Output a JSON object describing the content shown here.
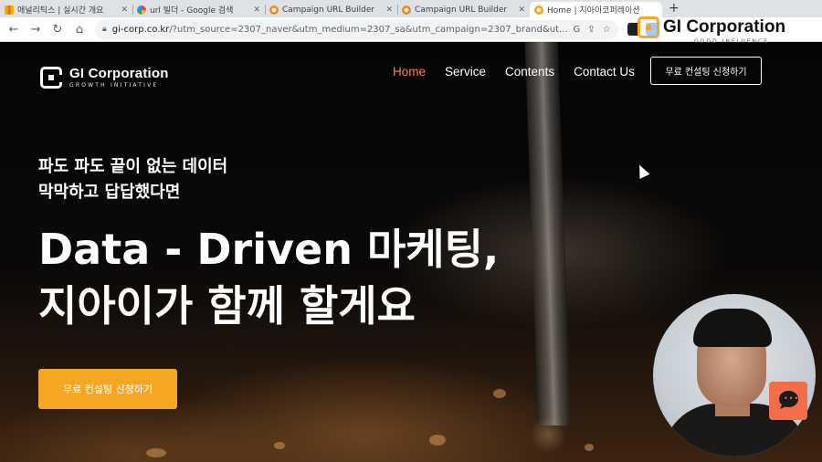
{
  "browser": {
    "tabs": [
      {
        "label": "애널리틱스 | 실시간 개요",
        "icon": "analytics-icon",
        "active": false
      },
      {
        "label": "url 빌더 - Google 검색",
        "icon": "google-icon",
        "active": false
      },
      {
        "label": "Campaign URL Builder",
        "icon": "gear-icon",
        "active": false
      },
      {
        "label": "Campaign URL Builder",
        "icon": "gear-icon",
        "active": false
      },
      {
        "label": "Home | 지아이코퍼레이션",
        "icon": "home-icon",
        "active": true
      }
    ],
    "new_tab": "+",
    "url_host": "gi-corp.co.kr",
    "url_path": "/?utm_source=2307_naver&utm_medium=2307_sa&utm_campaign=2307_brand&ut..."
  },
  "site": {
    "logo_name": "GI Corporation",
    "logo_sub": "GROWTH INITIATIVE",
    "nav": [
      "Home",
      "Service",
      "Contents",
      "Contact Us"
    ],
    "cta_top": "무료 컨설팅 신청하기",
    "hero_sub_1": "파도 파도 끝이 없는 데이터",
    "hero_sub_2": "막막하고 답답했다면",
    "hero_title_1": "Data - Driven 마케팅,",
    "hero_title_2": "지아이가 함께 할게요",
    "cta_main": "무료 컨설팅 신청하기"
  },
  "overlay": {
    "brand_name": "GI Corporation",
    "brand_sub": "GOOD INFLUENCE"
  },
  "colors": {
    "nav_active": "#f4825f",
    "cta_main_bg": "#f5a623",
    "chat_button": "#f36d4a"
  }
}
